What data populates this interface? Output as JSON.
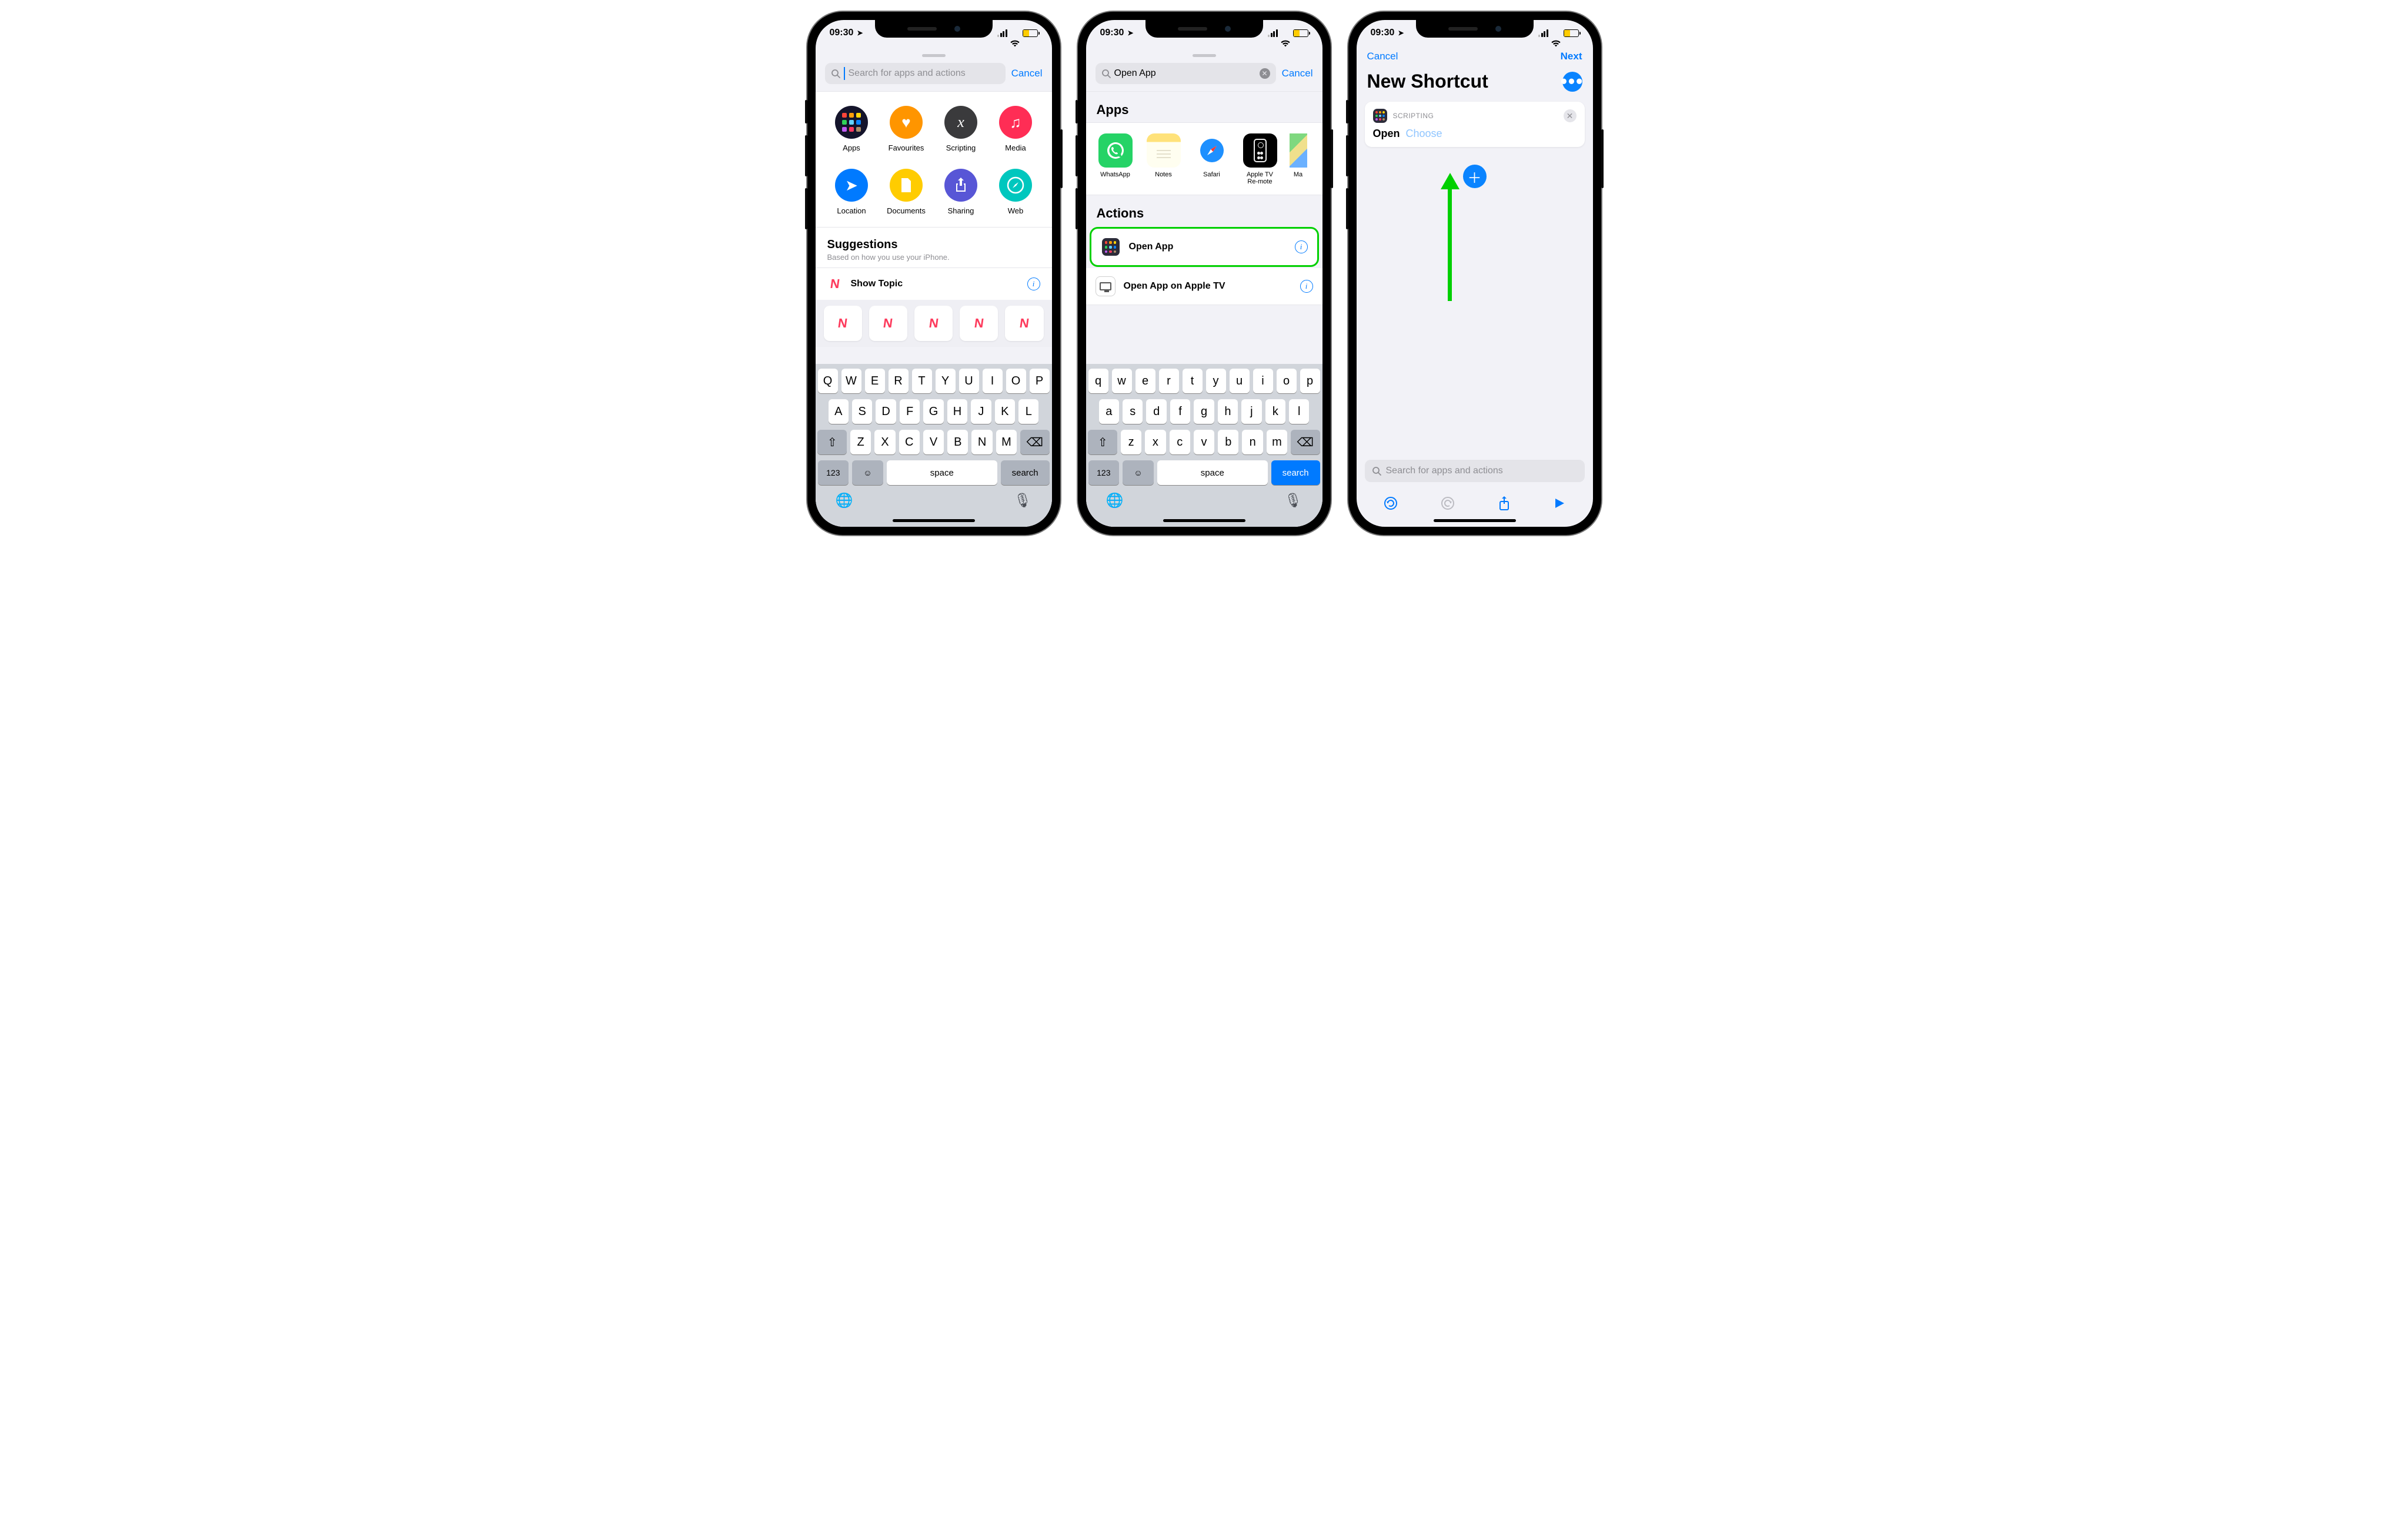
{
  "status": {
    "time": "09:30"
  },
  "bg_nav": {
    "cancel": "Cancel",
    "next": "Next"
  },
  "screen1": {
    "search_placeholder": "Search for apps and actions",
    "cancel": "Cancel",
    "categories": [
      {
        "label": "Apps",
        "color1": "#1a1a2e",
        "icon": "apps"
      },
      {
        "label": "Favourites",
        "color1": "#ff9500",
        "icon": "heart"
      },
      {
        "label": "Scripting",
        "color1": "#3a3a3c",
        "icon": "script"
      },
      {
        "label": "Media",
        "color1": "#ff2d55",
        "icon": "music"
      },
      {
        "label": "Location",
        "color1": "#007aff",
        "icon": "location"
      },
      {
        "label": "Documents",
        "color1": "#ffcc00",
        "icon": "doc"
      },
      {
        "label": "Sharing",
        "color1": "#5856d6",
        "icon": "share"
      },
      {
        "label": "Web",
        "color1": "#00c7be",
        "icon": "compass"
      }
    ],
    "suggestions_title": "Suggestions",
    "suggestions_sub": "Based on how you use your iPhone.",
    "suggestion_item": "Show Topic",
    "keys_r1": [
      "Q",
      "W",
      "E",
      "R",
      "T",
      "Y",
      "U",
      "I",
      "O",
      "P"
    ],
    "keys_r2": [
      "A",
      "S",
      "D",
      "F",
      "G",
      "H",
      "J",
      "K",
      "L"
    ],
    "keys_r3": [
      "Z",
      "X",
      "C",
      "V",
      "B",
      "N",
      "M"
    ],
    "key_123": "123",
    "key_space": "space",
    "key_search": "search"
  },
  "screen2": {
    "search_value": "Open App",
    "cancel": "Cancel",
    "apps_header": "Apps",
    "apps": [
      {
        "label": "WhatsApp",
        "bg": "#25d366",
        "icon": "phone"
      },
      {
        "label": "Notes",
        "bg": "#fff7cc",
        "icon": "notes"
      },
      {
        "label": "Safari",
        "bg": "#ffffff",
        "icon": "safari"
      },
      {
        "label": "Apple TV Re-mote",
        "bg": "#000000",
        "icon": "tvremote"
      },
      {
        "label": "Ma",
        "bg": "#ffffff",
        "icon": "maps"
      }
    ],
    "actions_header": "Actions",
    "actions": [
      {
        "label": "Open App",
        "highlight": true,
        "icon": "grid"
      },
      {
        "label": "Open App on Apple TV",
        "highlight": false,
        "icon": "tv"
      }
    ],
    "keys_r1": [
      "q",
      "w",
      "e",
      "r",
      "t",
      "y",
      "u",
      "i",
      "o",
      "p"
    ],
    "keys_r2": [
      "a",
      "s",
      "d",
      "f",
      "g",
      "h",
      "j",
      "k",
      "l"
    ],
    "keys_r3": [
      "z",
      "x",
      "c",
      "v",
      "b",
      "n",
      "m"
    ],
    "key_123": "123",
    "key_space": "space",
    "key_search": "search"
  },
  "screen3": {
    "nav_cancel": "Cancel",
    "nav_next": "Next",
    "title": "New Shortcut",
    "card_source": "SCRIPTING",
    "card_open": "Open",
    "card_choose": "Choose",
    "search_placeholder": "Search for apps and actions"
  }
}
